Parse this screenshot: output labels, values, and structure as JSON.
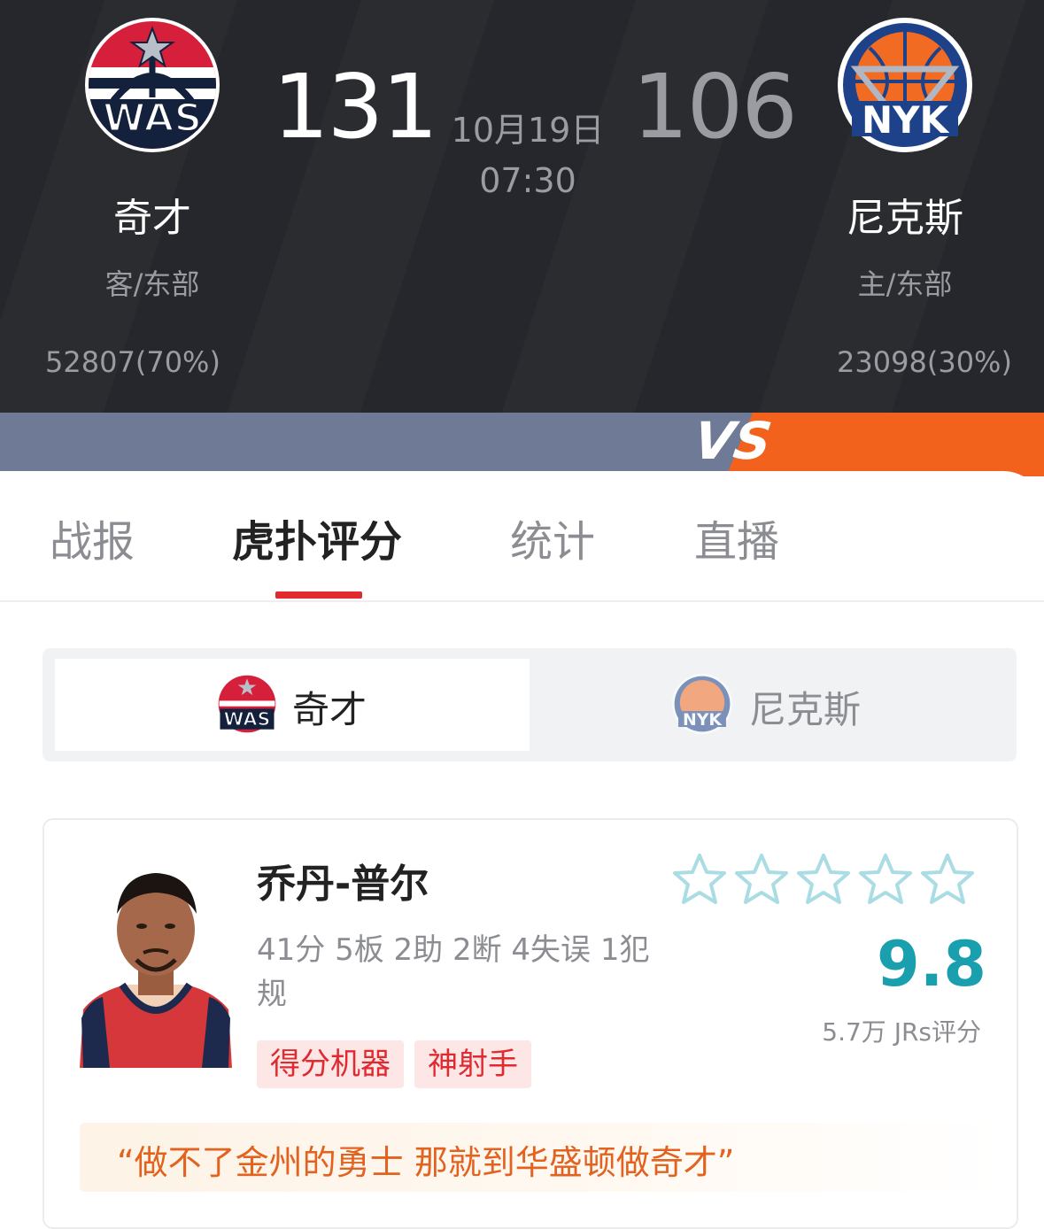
{
  "game": {
    "date": "10月19日",
    "time": "07:30"
  },
  "away_team": {
    "abbr": "WAS",
    "name": "奇才",
    "side": "客/东部",
    "votes": "52807(70%)",
    "score": "131",
    "color": "#ffffff"
  },
  "home_team": {
    "abbr": "NYK",
    "name": "尼克斯",
    "side": "主/东部",
    "votes": "23098(30%)",
    "score": "106",
    "color": "#9a9ca2"
  },
  "vs_bar": {
    "label": "VS",
    "away_share": 0.7,
    "away_color": "#6e7a96",
    "home_color": "#f2621c"
  },
  "tabs": [
    {
      "label": "战报",
      "active": false
    },
    {
      "label": "虎扑评分",
      "active": true
    },
    {
      "label": "统计",
      "active": false
    },
    {
      "label": "直播",
      "active": false
    }
  ],
  "team_switcher": {
    "left_label": "奇才",
    "right_label": "尼克斯",
    "selected": "left"
  },
  "player_card": {
    "name": "乔丹-普尔",
    "stats": "41分 5板 2助 2断 4失误 1犯规",
    "tags": [
      "得分机器",
      "神射手"
    ],
    "stars_filled": 0,
    "stars_total": 5,
    "rating": "9.8",
    "rating_count": "5.7万 JRs评分",
    "quote": "“做不了金州的勇士 那就到华盛顿做奇才”",
    "accent_color": "#1a9fae"
  }
}
